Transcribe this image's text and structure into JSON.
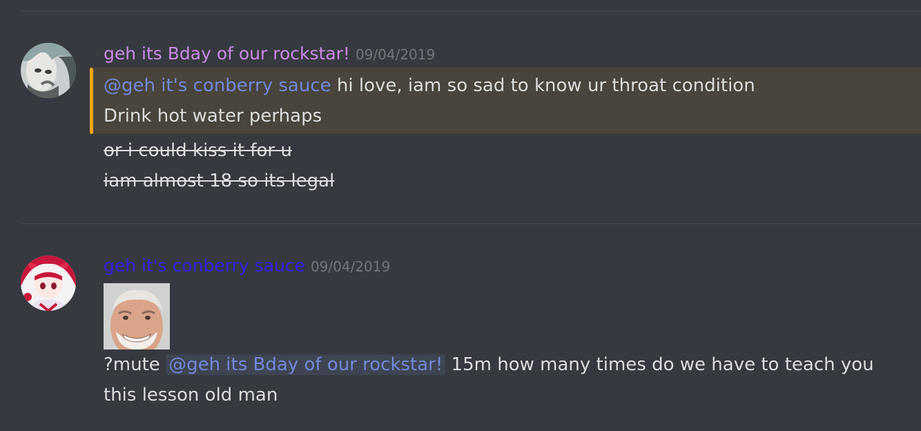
{
  "messages": [
    {
      "username": "geh its Bday of our rockstar!",
      "username_color": "#c98be7",
      "timestamp": "09/04/2019",
      "highlighted_lines": {
        "mention": "@geh it's conberry sauce",
        "line1_rest": " hi love, iam so sad to know ur throat condition",
        "line2": "Drink hot water perhaps"
      },
      "strikethrough_lines": [
        "or i could kiss it for u",
        "iam almost 18 so its legal"
      ]
    },
    {
      "username": "geh it's conberry sauce",
      "username_color": "#3522ee",
      "timestamp": "09/04/2019",
      "attachment": "old-man-meme-image",
      "text": {
        "prefix": "?mute ",
        "mention": "@geh its Bday of our rockstar!",
        "rest": " 15m how many times do we have to teach you",
        "line2": "this lesson old man"
      }
    }
  ],
  "colors": {
    "background": "#36393f",
    "mention": "#7289da",
    "highlight_bg": "#49443c",
    "highlight_bar": "#faa61a",
    "text": "#dcddde",
    "timestamp": "#72767d"
  }
}
